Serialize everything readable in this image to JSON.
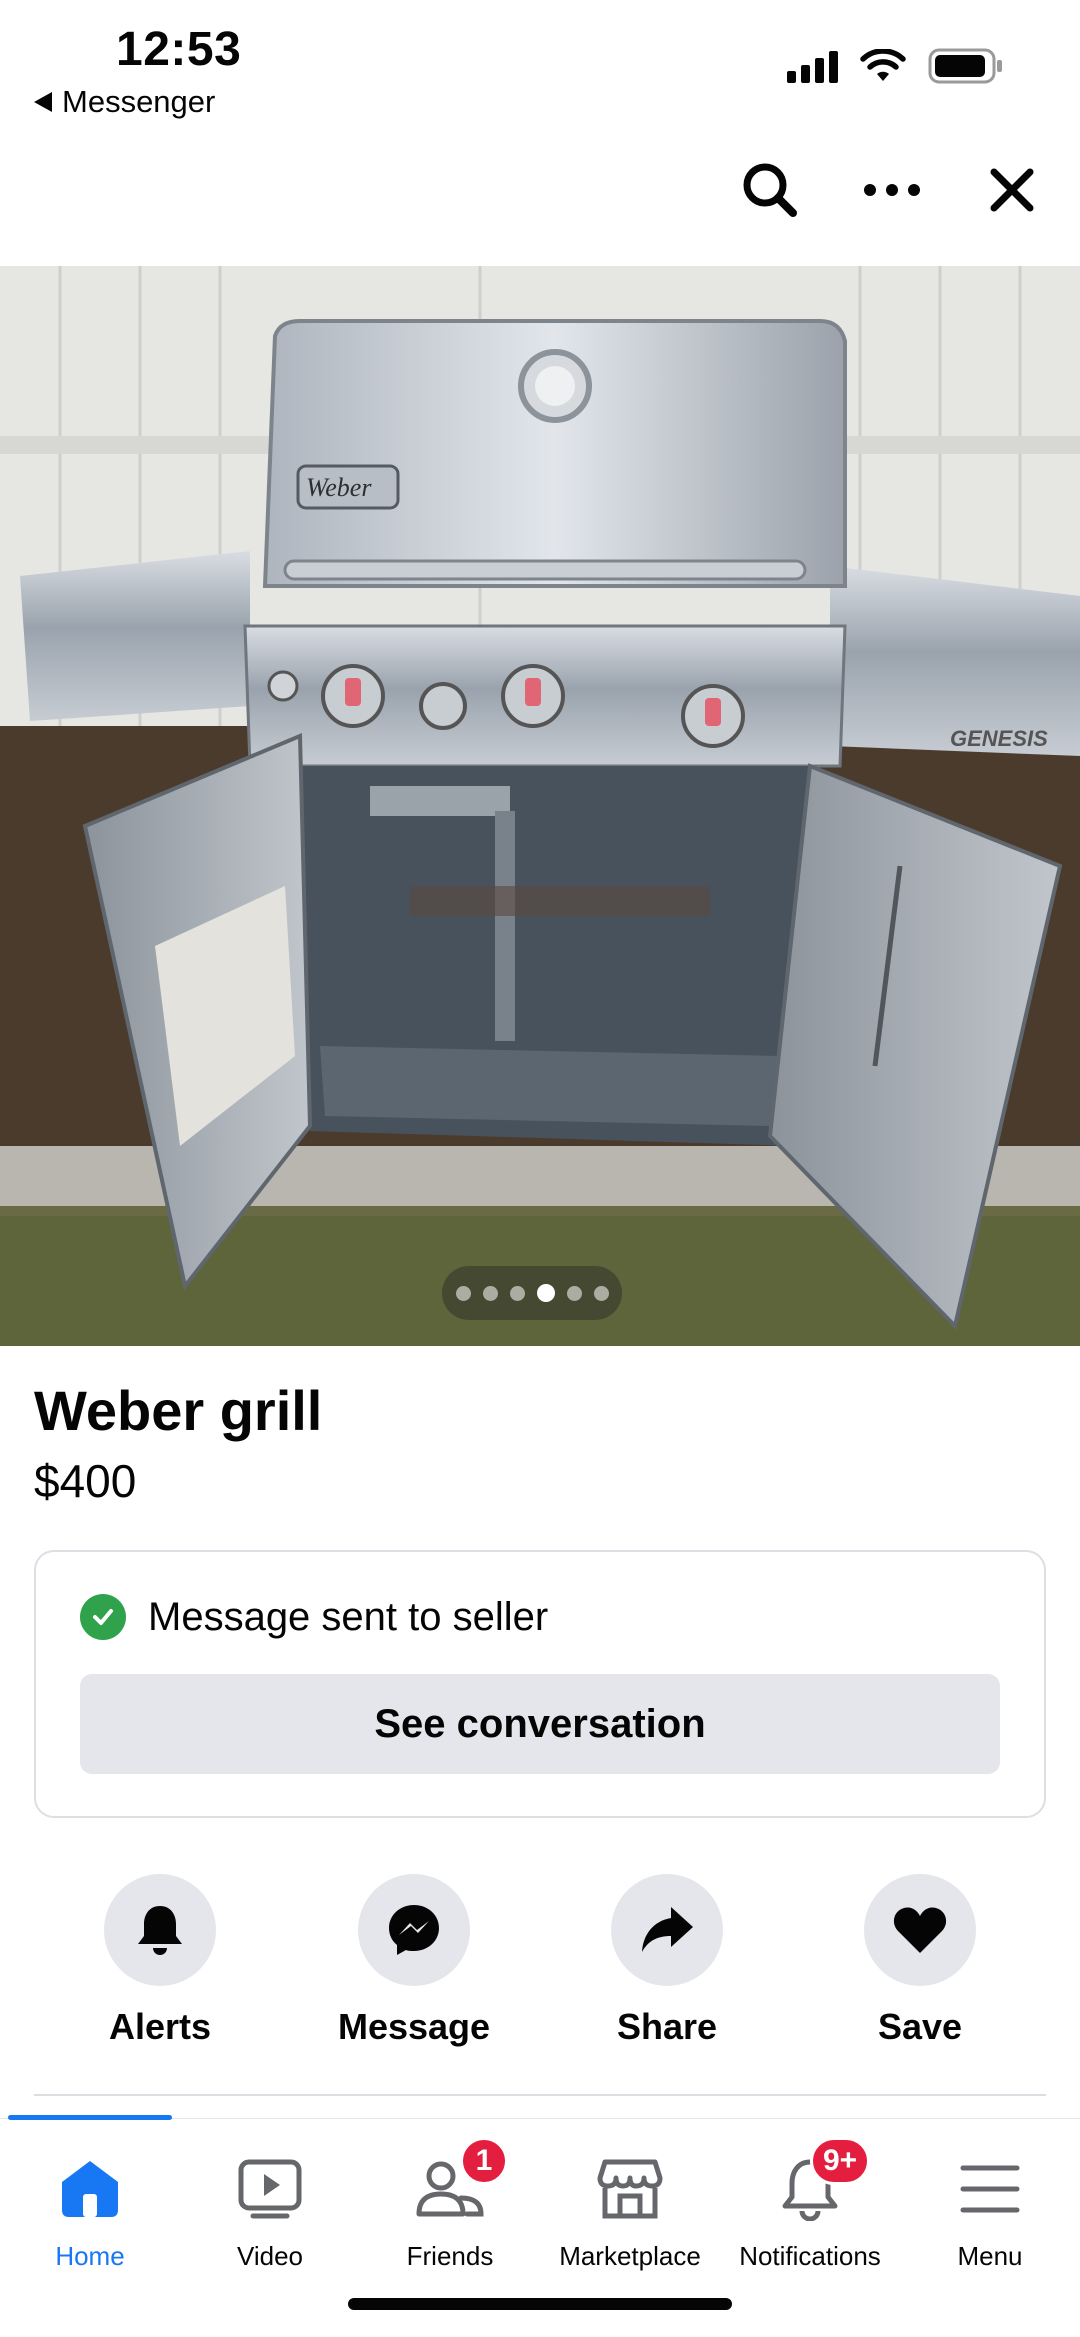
{
  "status_bar": {
    "time": "12:53",
    "back_app": "Messenger"
  },
  "top_actions": {
    "icons": [
      "search-icon",
      "more-icon",
      "close-icon"
    ]
  },
  "photo": {
    "description_icon": "grill-photo",
    "brand_text": "Weber",
    "model_text": "GENESIS",
    "carousel": {
      "count": 6,
      "active_index": 3
    }
  },
  "listing": {
    "title": "Weber grill",
    "price": "$400"
  },
  "message_card": {
    "status_text": "Message sent to seller",
    "button_label": "See conversation"
  },
  "actions": [
    {
      "label": "Alerts",
      "icon": "bell-icon"
    },
    {
      "label": "Message",
      "icon": "messenger-icon"
    },
    {
      "label": "Share",
      "icon": "share-icon"
    },
    {
      "label": "Save",
      "icon": "heart-icon"
    }
  ],
  "bottom_nav": [
    {
      "label": "Home",
      "icon": "home-icon",
      "active": true
    },
    {
      "label": "Video",
      "icon": "video-icon"
    },
    {
      "label": "Friends",
      "icon": "friends-icon",
      "badge": "1"
    },
    {
      "label": "Marketplace",
      "icon": "marketplace-icon"
    },
    {
      "label": "Notifications",
      "icon": "bell-icon",
      "badge": "9+"
    },
    {
      "label": "Menu",
      "icon": "menu-icon"
    }
  ],
  "colors": {
    "accent": "#1877f2",
    "success": "#31a24c",
    "badge": "#e41e3f",
    "button_bg": "#e4e6eb"
  }
}
